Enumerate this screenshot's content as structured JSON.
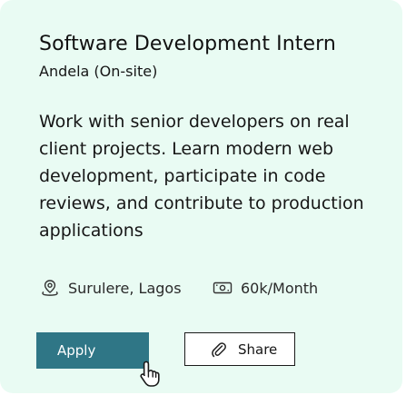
{
  "job": {
    "title": "Software Development Intern",
    "company": "Andela (On-site)",
    "description": "Work with senior developers on real client projects. Learn modern web development, participate in code reviews, and contribute to production applications",
    "location": "Surulere, Lagos",
    "salary": "60k/Month"
  },
  "actions": {
    "apply_label": "Apply",
    "share_label": "Share"
  },
  "icons": {
    "location": "map-pin-icon",
    "salary": "money-icon",
    "share": "paperclip-icon",
    "cursor": "hand-pointer-icon"
  },
  "colors": {
    "card_background": "#e9fbf3",
    "apply_button": "#2f7686",
    "text": "#161616"
  }
}
